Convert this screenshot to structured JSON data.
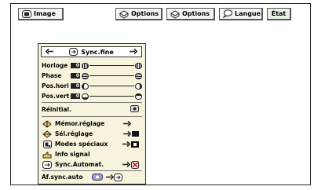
{
  "toolbar": {
    "image_label": "Image",
    "options1_label": "Options",
    "options2_label": "Options",
    "langue_label": "Langue",
    "etat_label": "État"
  },
  "sync_panel": {
    "title": "Sync.fine",
    "sliders": [
      {
        "label": "Horloge",
        "value": "0"
      },
      {
        "label": "Phase",
        "value": "0"
      },
      {
        "label": "Pos.hori",
        "value": "0"
      },
      {
        "label": "Pos.vert",
        "value": "0"
      }
    ],
    "reset_label": "Réinitial."
  },
  "menu": {
    "items": [
      {
        "label": "Mémor.réglage",
        "icon": "memory-diamond-icon"
      },
      {
        "label": "Sél.réglage",
        "icon": "select-diamond-icon"
      },
      {
        "label": "Modes spéciaux",
        "icon": "special-modes-icon"
      },
      {
        "label": "Info signal",
        "icon": "hand-signal-icon"
      },
      {
        "label": "Sync.Automat.",
        "icon": "auto-sync-icon"
      },
      {
        "label": "Af.sync.auto",
        "icon": ""
      }
    ]
  },
  "colors": {
    "panel_bg": "#f7f3dc",
    "etat_bg": "#e6f2e2",
    "auto_sync_off": "#d22222"
  }
}
